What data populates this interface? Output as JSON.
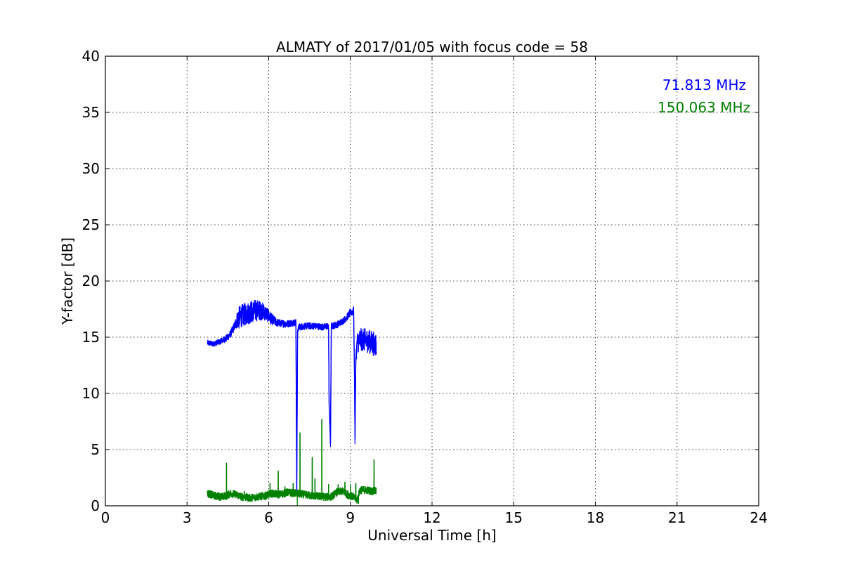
{
  "chart_data": {
    "type": "line",
    "title": "ALMATY of 2017/01/05 with focus code = 58",
    "xlabel": "Universal Time [h]",
    "ylabel": "Y-factor [dB]",
    "xlim": [
      0,
      24
    ],
    "ylim": [
      0,
      40
    ],
    "xticks": [
      0,
      3,
      6,
      9,
      12,
      15,
      18,
      21,
      24
    ],
    "yticks": [
      0,
      5,
      10,
      15,
      20,
      25,
      30,
      35,
      40
    ],
    "grid": true,
    "legend_position": "top-right",
    "series": [
      {
        "name": "71.813 MHz",
        "color": "#0000ff",
        "points": [
          [
            3.75,
            14.5
          ],
          [
            3.95,
            14.4
          ],
          [
            4.2,
            14.6
          ],
          [
            4.45,
            14.9
          ],
          [
            4.6,
            15.3
          ],
          [
            4.75,
            16.0
          ],
          [
            4.85,
            16.6
          ],
          [
            5.0,
            16.9
          ],
          [
            5.2,
            17.1
          ],
          [
            5.4,
            17.3
          ],
          [
            5.6,
            17.4
          ],
          [
            5.8,
            17.3
          ],
          [
            5.95,
            17.0
          ],
          [
            6.1,
            16.6
          ],
          [
            6.3,
            16.3
          ],
          [
            6.5,
            16.2
          ],
          [
            6.7,
            16.2
          ],
          [
            6.9,
            16.3
          ],
          [
            7.0,
            16.3
          ],
          [
            7.03,
            1.0
          ],
          [
            7.06,
            15.5
          ],
          [
            7.1,
            15.9
          ],
          [
            7.4,
            16.0
          ],
          [
            7.7,
            16.0
          ],
          [
            8.0,
            15.9
          ],
          [
            8.15,
            16.0
          ],
          [
            8.2,
            15.8
          ],
          [
            8.22,
            9.0
          ],
          [
            8.27,
            5.5
          ],
          [
            8.3,
            16.0
          ],
          [
            8.5,
            16.1
          ],
          [
            8.7,
            16.4
          ],
          [
            8.85,
            16.7
          ],
          [
            9.0,
            17.2
          ],
          [
            9.12,
            17.3
          ],
          [
            9.15,
            12.0
          ],
          [
            9.17,
            6.0
          ],
          [
            9.2,
            13.0
          ],
          [
            9.25,
            14.6
          ],
          [
            9.4,
            14.8
          ],
          [
            9.6,
            14.7
          ],
          [
            9.8,
            14.5
          ],
          [
            9.95,
            14.3
          ]
        ],
        "band": [
          [
            3.75,
            0.25
          ],
          [
            4.2,
            0.25
          ],
          [
            4.75,
            0.4
          ],
          [
            4.9,
            1.0
          ],
          [
            5.5,
            1.0
          ],
          [
            6.0,
            0.6
          ],
          [
            6.3,
            0.35
          ],
          [
            7.0,
            0.3
          ],
          [
            8.8,
            0.3
          ],
          [
            9.1,
            0.35
          ],
          [
            9.3,
            1.0
          ],
          [
            9.95,
            1.1
          ]
        ]
      },
      {
        "name": "150.063 MHz",
        "color": "#008000",
        "points": [
          [
            3.75,
            1.1
          ],
          [
            4.0,
            0.9
          ],
          [
            4.3,
            0.8
          ],
          [
            4.45,
            0.9
          ],
          [
            4.6,
            1.1
          ],
          [
            4.8,
            1.0
          ],
          [
            5.0,
            0.8
          ],
          [
            5.3,
            0.7
          ],
          [
            5.6,
            0.8
          ],
          [
            5.9,
            0.9
          ],
          [
            6.1,
            1.1
          ],
          [
            6.4,
            1.0
          ],
          [
            6.7,
            1.2
          ],
          [
            7.0,
            1.1
          ],
          [
            7.3,
            1.0
          ],
          [
            7.6,
            0.9
          ],
          [
            8.0,
            0.8
          ],
          [
            8.3,
            0.8
          ],
          [
            8.5,
            1.2
          ],
          [
            8.7,
            1.3
          ],
          [
            8.9,
            1.0
          ],
          [
            9.1,
            0.8
          ],
          [
            9.25,
            0.5
          ],
          [
            9.35,
            1.4
          ],
          [
            9.6,
            1.4
          ],
          [
            9.8,
            1.3
          ],
          [
            9.95,
            1.3
          ]
        ],
        "spikes": [
          [
            4.45,
            3.8
          ],
          [
            5.1,
            1.3
          ],
          [
            6.05,
            2.0
          ],
          [
            6.35,
            3.1
          ],
          [
            6.6,
            1.7
          ],
          [
            6.9,
            2.0
          ],
          [
            7.15,
            6.5
          ],
          [
            7.6,
            4.3
          ],
          [
            7.7,
            2.4
          ],
          [
            7.95,
            7.7
          ],
          [
            8.2,
            1.9
          ],
          [
            8.55,
            1.9
          ],
          [
            8.8,
            2.1
          ],
          [
            9.0,
            1.9
          ],
          [
            9.2,
            2.0
          ],
          [
            9.87,
            4.1
          ]
        ],
        "dips": [
          [
            7.05,
            0.0
          ],
          [
            9.3,
            0.2
          ]
        ],
        "band": [
          [
            3.75,
            0.35
          ],
          [
            9.95,
            0.35
          ]
        ]
      }
    ]
  }
}
